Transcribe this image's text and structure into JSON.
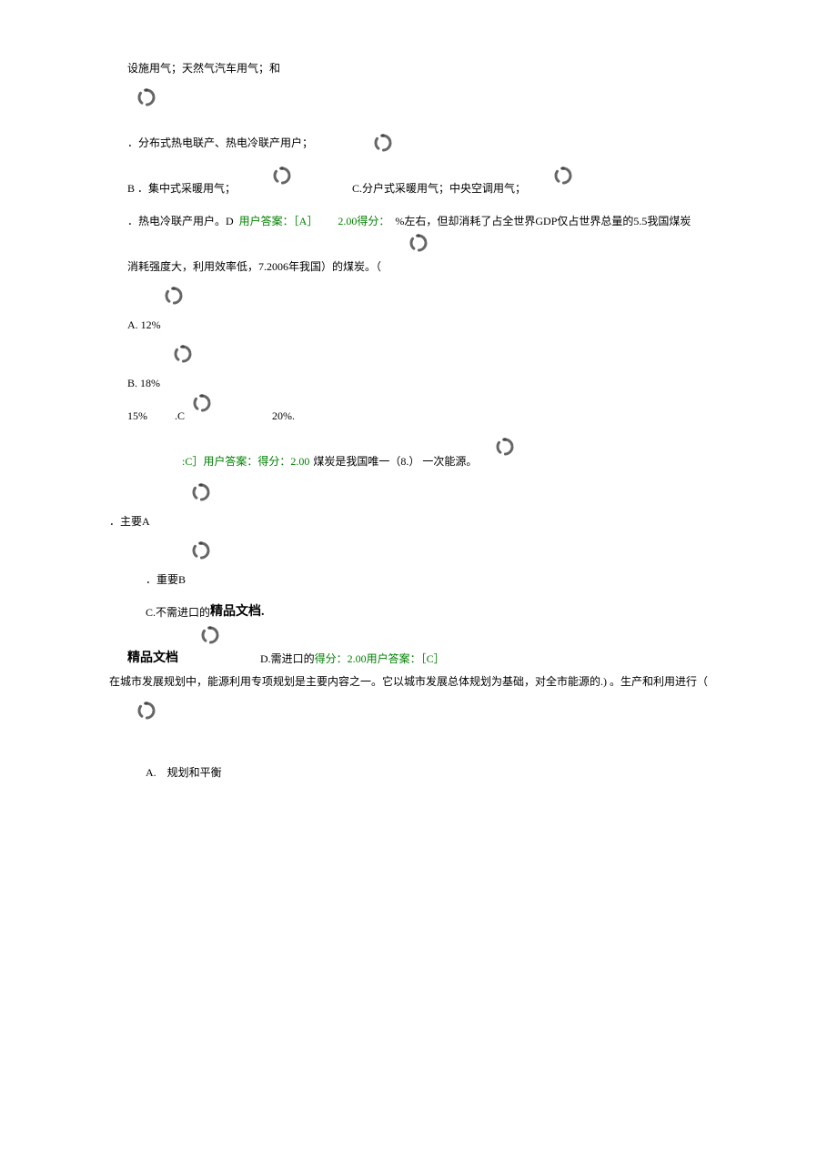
{
  "top_fragment": "设施用气；天然气汽车用气；和",
  "q6": {
    "opt_a_text": "．分布式热电联产、热电冷联产用户；",
    "opt_b_text": "B ．集中式采暖用气；",
    "opt_c_text": "C.分户式采暖用气；中央空调用气；",
    "opt_d_prefix": "．热电冷联产用户。D",
    "ans_label": "用户答案：［A］",
    "score_label": "2.00得分："
  },
  "q7": {
    "stem_part1": "%左右，但却消耗了占全世界GDP仅占世界总量的5.5我国煤炭",
    "stem_part2": "消耗强度大，利用效率低，7.2006年我国）的煤炭。（",
    "opt_a": "A.  12%",
    "opt_b": "B.  18%",
    "opt_c_left": "15%",
    "opt_c_mid": ".C",
    "opt_c_right": "20%.",
    "ans": ":C］用户答案：得分：2.00"
  },
  "q8": {
    "stem": "煤炭是我国唯一（8.） 一次能源。",
    "opt_a": "．主要A",
    "opt_b": "．重要B",
    "opt_c_prefix": "C.不需进口的",
    "boutique1": "精品文档.",
    "boutique2": "精品文档",
    "opt_d_prefix": "D.需进口的",
    "score": "得分：2.00用户答案：［C］"
  },
  "q9": {
    "stem": "在城市发展规划中，能源利用专项规划是主要内容之一。它以城市发展总体规划为基础，对全市能源的.) 。生产和利用进行（",
    "opt_a": "A.　规划和平衡"
  }
}
